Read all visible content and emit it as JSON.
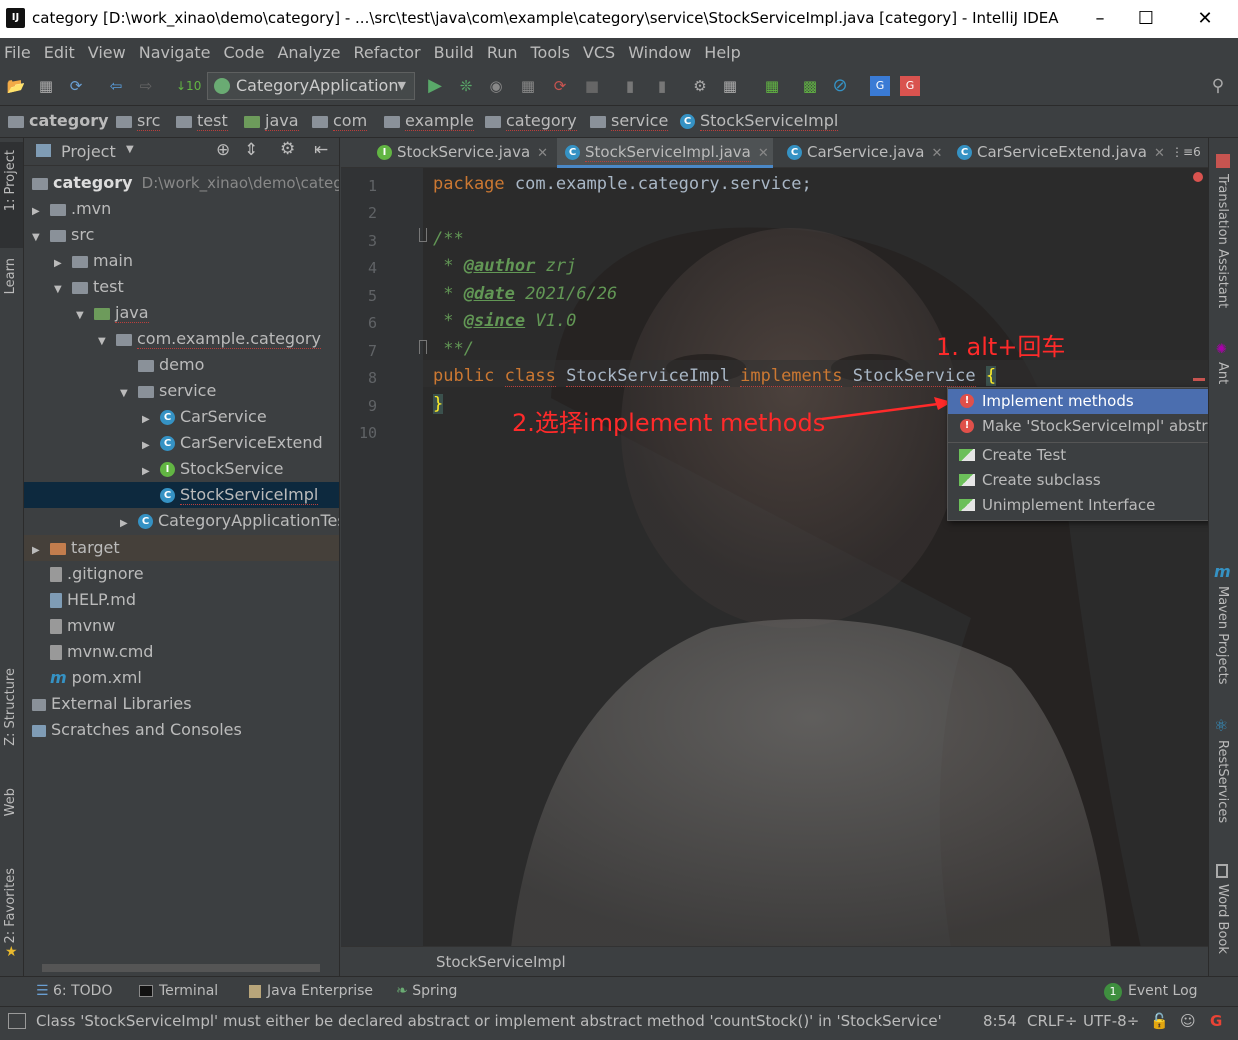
{
  "window": {
    "title": "category [D:\\work_xinao\\demo\\category] - ...\\src\\test\\java\\com\\example\\category\\service\\StockServiceImpl.java [category] - IntelliJ IDEA",
    "app_icon": "IJ"
  },
  "menu": [
    "File",
    "Edit",
    "View",
    "Navigate",
    "Code",
    "Analyze",
    "Refactor",
    "Build",
    "Run",
    "Tools",
    "VCS",
    "Window",
    "Help"
  ],
  "toolbar": {
    "run_config": "CategoryApplication"
  },
  "breadcrumbs": [
    "category",
    "src",
    "test",
    "java",
    "com",
    "example",
    "category",
    "service",
    "StockServiceImpl"
  ],
  "left_strip": {
    "project": "1: Project",
    "learn": "Learn",
    "structure": "Z: Structure",
    "web": "Web",
    "favorites": "2: Favorites"
  },
  "project": {
    "title": "Project",
    "root_name": "category",
    "root_path": "D:\\work_xinao\\demo\\category",
    "items": [
      {
        "label": ".mvn"
      },
      {
        "label": "src"
      },
      {
        "label": "main"
      },
      {
        "label": "test"
      },
      {
        "label": "java"
      },
      {
        "label": "com.example.category"
      },
      {
        "label": "demo"
      },
      {
        "label": "service"
      },
      {
        "label": "CarService"
      },
      {
        "label": "CarServiceExtend"
      },
      {
        "label": "StockService"
      },
      {
        "label": "StockServiceImpl"
      },
      {
        "label": "CategoryApplicationTests"
      },
      {
        "label": "target"
      },
      {
        "label": ".gitignore"
      },
      {
        "label": "HELP.md"
      },
      {
        "label": "mvnw"
      },
      {
        "label": "mvnw.cmd"
      },
      {
        "label": "pom.xml"
      },
      {
        "label": "External Libraries"
      },
      {
        "label": "Scratches and Consoles"
      }
    ]
  },
  "tabs": [
    {
      "label": "StockService.java"
    },
    {
      "label": "StockServiceImpl.java"
    },
    {
      "label": "CarService.java"
    },
    {
      "label": "CarServiceExtend.java"
    }
  ],
  "tab_overflow": "6",
  "code": {
    "line_numbers": [
      "1",
      "2",
      "3",
      "4",
      "5",
      "6",
      "7",
      "8",
      "9",
      "10"
    ],
    "package_kw": "package",
    "package_name": " com.example.category.service;",
    "doc_open": "/**",
    "author_tag": "@author",
    "author_val": " zrj",
    "date_tag": "@date",
    "date_val": " 2021/6/26",
    "since_tag": "@since",
    "since_val": " V1.0",
    "doc_close": " **/",
    "public_kw": "public",
    "class_kw": "class",
    "class_name": "StockServiceImpl",
    "implements_kw": "implements",
    "iface_name": "StockService",
    "open_brace": "{",
    "close_brace": "}"
  },
  "popup": {
    "items": [
      {
        "label": "Implement methods"
      },
      {
        "label": "Make 'StockServiceImpl' abstract"
      },
      {
        "label": "Create Test"
      },
      {
        "label": "Create subclass"
      },
      {
        "label": "Unimplement Interface"
      }
    ]
  },
  "annotations": {
    "step1": "1. alt+回车",
    "step2": "2.选择implement methods"
  },
  "right_strip": {
    "translation": "Translation Assistant",
    "ant": "Ant",
    "maven": "Maven Projects",
    "rest": "RestServices",
    "wordbook": "Word Book"
  },
  "editor_footer": "StockServiceImpl",
  "tool_windows": [
    {
      "label": "6: TODO"
    },
    {
      "label": "Terminal"
    },
    {
      "label": "Java Enterprise"
    },
    {
      "label": "Spring"
    }
  ],
  "event_log": "Event Log",
  "event_count": "1",
  "status": {
    "message": "Class 'StockServiceImpl' must either be declared abstract or implement abstract method 'countStock()' in 'StockService'",
    "position": "8:54",
    "line_sep": "CRLF÷",
    "encoding": "UTF-8÷"
  },
  "colors": {
    "accent": "#4b6eaf",
    "annotation": "#ff2a2a",
    "editor_bg": "#2b2b2b",
    "panel_bg": "#3c3f41"
  }
}
